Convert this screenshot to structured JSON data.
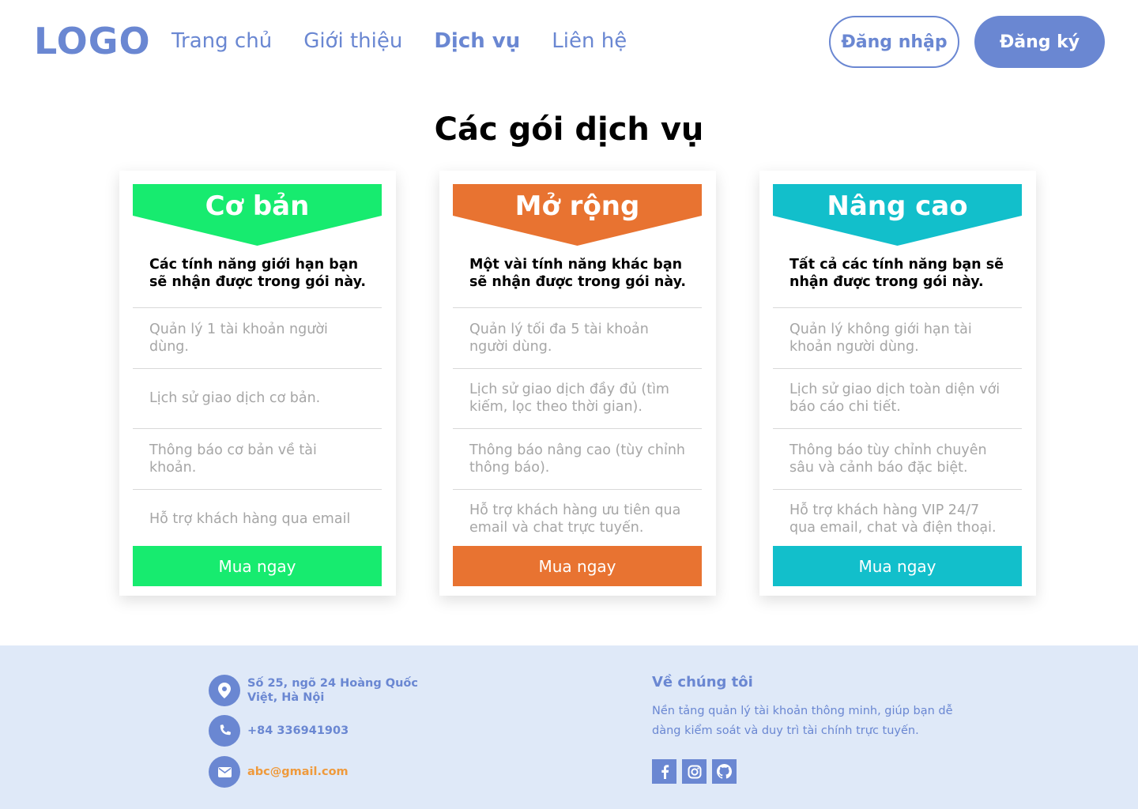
{
  "header": {
    "logo": "LOGO",
    "nav": [
      "Trang chủ",
      "Giới thiệu",
      "Dịch vụ",
      "Liên hệ"
    ],
    "active_nav": "Dịch vụ",
    "login_label": "Đăng nhập",
    "register_label": "Đăng ký"
  },
  "main": {
    "title": "Các gói dịch vụ",
    "plans": [
      {
        "name": "Cơ bản",
        "color": "#17eb6f",
        "description": "Các tính năng giới hạn bạn sẽ nhận được trong gói này.",
        "features": [
          "Quản lý 1 tài khoản người dùng.",
          "Lịch sử giao dịch cơ bản.",
          "Thông báo cơ bản về tài khoản.",
          "Hỗ trợ khách hàng qua email"
        ],
        "button_label": "Mua ngay"
      },
      {
        "name": "Mở rộng",
        "color": "#e87331",
        "description": "Một vài tính năng khác bạn sẽ nhận được trong gói này.",
        "features": [
          "Quản lý tối đa 5 tài khoản người dùng.",
          "Lịch sử giao dịch đầy đủ (tìm kiếm, lọc theo thời gian).",
          "Thông báo nâng cao (tùy chỉnh thông báo).",
          "Hỗ trợ khách hàng ưu tiên qua email và chat trực tuyến."
        ],
        "button_label": "Mua ngay"
      },
      {
        "name": "Nâng cao",
        "color": "#12bfcb",
        "description": "Tất cả các tính năng bạn sẽ nhận được trong gói này.",
        "features": [
          "Quản lý không giới hạn tài khoản người dùng.",
          "Lịch sử giao dịch toàn diện với báo cáo chi tiết.",
          "Thông báo tùy chỉnh chuyên sâu và cảnh báo đặc biệt.",
          "Hỗ trợ khách hàng VIP 24/7 qua email, chat và điện thoại."
        ],
        "button_label": "Mua ngay"
      }
    ]
  },
  "footer": {
    "address": "Số 25,  ngõ 24 Hoàng Quốc Việt, Hà Nội",
    "phone": "+84 336941903",
    "email": "abc@gmail.com",
    "about_title": "Về chúng tôi",
    "about_text": "Nền tảng quản lý tài khoản thông minh, giúp bạn dễ dàng kiểm soát và duy trì tài chính trực tuyến.",
    "socials": [
      "facebook-icon",
      "instagram-icon",
      "github-icon"
    ]
  },
  "colors": {
    "accent": "#6a87d2",
    "footer_bg": "#dfe9f8",
    "email_color": "#ef9a3c"
  }
}
